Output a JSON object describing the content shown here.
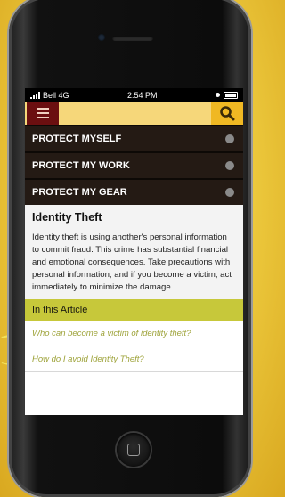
{
  "status": {
    "carrier": "Bell 4G",
    "time": "2:54 PM"
  },
  "appbar": {
    "menu_icon": "hamburger-menu-icon",
    "search_icon": "search-icon"
  },
  "nav": [
    {
      "label": "PROTECT MYSELF"
    },
    {
      "label": "PROTECT MY WORK"
    },
    {
      "label": "PROTECT MY GEAR"
    }
  ],
  "article": {
    "title": "Identity Theft",
    "body": "Identity theft is using another's personal information to commit fraud. This crime has substantial financial and emotional consequences. Take precautions with personal information, and if you become a victim, act immediately to minimize the damage."
  },
  "toc": {
    "header": "In this Article",
    "items": [
      "Who can become a victim of identity theft?",
      "How do I avoid Identity Theft?"
    ]
  },
  "colors": {
    "brand_red": "#6b0f10",
    "accent_yellow": "#f0b823",
    "nav_dark": "#241a14",
    "toc_green": "#c7c83a"
  }
}
